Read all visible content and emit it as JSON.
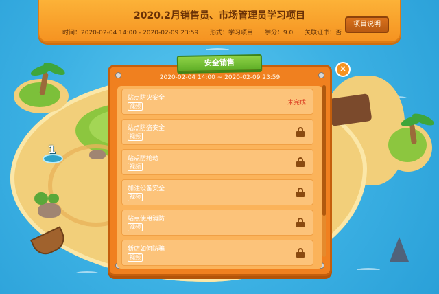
{
  "header": {
    "title": "2020.2月销售员、市场管理员学习项目",
    "time": "时间：2020-02-04 14:00 - 2020-02-09 23:59",
    "format": "形式：学习项目",
    "credit": "学分：9.0",
    "certificate": "关联证书：否",
    "project_button": "项目说明"
  },
  "map": {
    "level_number": "1"
  },
  "panel": {
    "banner": "安全销售",
    "date_range": "2020-02-04 14:00 ~ 2020-02-09 23:59",
    "close_icon": "×",
    "items": [
      {
        "name": "站点防火安全",
        "tag": "视频",
        "status": "未完成",
        "locked": false
      },
      {
        "name": "站点防盗安全",
        "tag": "视频",
        "status": "",
        "locked": true
      },
      {
        "name": "站点防抢劫",
        "tag": "视频",
        "status": "",
        "locked": true
      },
      {
        "name": "加注设备安全",
        "tag": "视频",
        "status": "",
        "locked": true
      },
      {
        "name": "站点使用消防",
        "tag": "视频",
        "status": "",
        "locked": true
      },
      {
        "name": "新店如何防骗",
        "tag": "视频",
        "status": "",
        "locked": true
      }
    ]
  },
  "colors": {
    "accent": "#f59321",
    "status_incomplete": "#d9341c",
    "banner_green": "#6bbb2f"
  },
  "icons": [
    "close-icon",
    "lock-icon",
    "screw-icon"
  ]
}
